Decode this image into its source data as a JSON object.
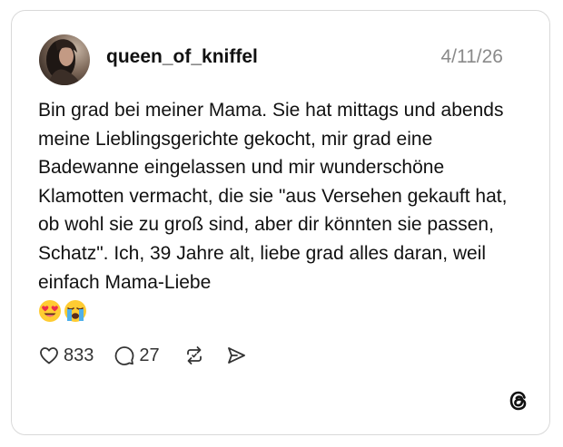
{
  "post": {
    "username": "queen_of_kniffel",
    "date": "4/11/26",
    "text": "Bin grad bei meiner Mama. Sie hat mittags und abends meine Lieblingsgerichte gekocht, mir grad eine Badewanne eingelassen und mir wunderschöne Klamotten vermacht, die sie \"aus Versehen gekauft hat, ob wohl sie zu groß sind, aber dir könnten sie passen, Schatz\". Ich, 39 Jahre alt, liebe grad alles daran, weil einfach Mama-Liebe",
    "emojis": [
      "heart-eyes-emoji",
      "loudly-crying-emoji"
    ]
  },
  "actions": {
    "likes": "833",
    "replies": "27",
    "icons": [
      "heart-icon",
      "comment-icon",
      "repost-icon",
      "share-icon"
    ]
  },
  "branding": {
    "logo": "threads-logo-icon"
  },
  "colors": {
    "text": "#111111",
    "muted": "#8a8a8a",
    "border": "#d9d9d9"
  }
}
